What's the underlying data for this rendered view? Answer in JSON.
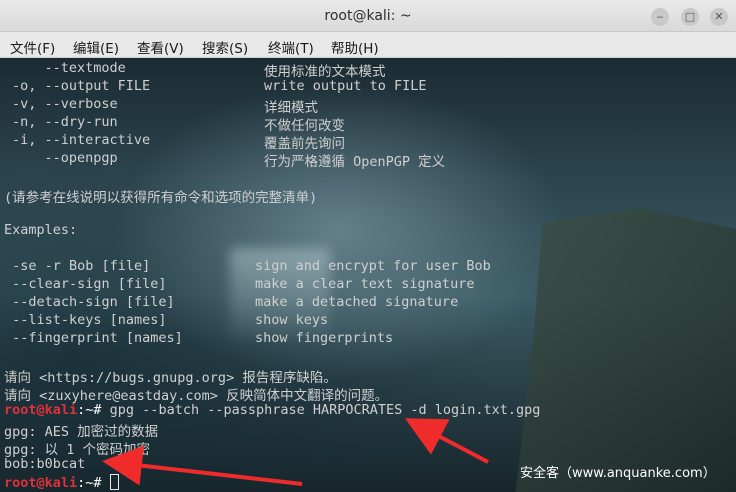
{
  "window": {
    "title": "root@kali: ~",
    "controls": {
      "minimize": "‒",
      "maximize": "□",
      "close": "✕"
    }
  },
  "menu": [
    "文件(F)",
    "编辑(E)",
    "查看(V)",
    "搜索(S)",
    "终端(T)",
    "帮助(H)"
  ],
  "options": [
    {
      "flag": "    --textmode",
      "desc": "使用标准的文本模式"
    },
    {
      "flag": "-o, --output FILE",
      "desc": "write output to FILE"
    },
    {
      "flag": "-v, --verbose",
      "desc": "详细模式"
    },
    {
      "flag": "-n, --dry-run",
      "desc": "不做任何改变"
    },
    {
      "flag": "-i, --interactive",
      "desc": "覆盖前先询问"
    },
    {
      "flag": "    --openpgp",
      "desc": "行为严格遵循 OpenPGP 定义"
    }
  ],
  "note": "(请参考在线说明以获得所有命令和选项的完整清单)",
  "examples_header": "Examples:",
  "examples": [
    {
      "cmd": " -se -r Bob [file]",
      "desc": "sign and encrypt for user Bob"
    },
    {
      "cmd": " --clear-sign [file]",
      "desc": "make a clear text signature"
    },
    {
      "cmd": " --detach-sign [file]",
      "desc": "make a detached signature"
    },
    {
      "cmd": " --list-keys [names]",
      "desc": "show keys"
    },
    {
      "cmd": " --fingerprint [names]",
      "desc": "show fingerprints"
    }
  ],
  "report": [
    "请向 <https://bugs.gnupg.org> 报告程序缺陷。",
    "请向 <zuxyhere@eastday.com> 反映简体中文翻译的问题。"
  ],
  "prompt": {
    "user": "root@kali",
    "sep": ":~# "
  },
  "command": "gpg --batch --passphrase HARPOCRATES -d login.txt.gpg",
  "output": [
    "gpg: AES 加密过的数据",
    "gpg: 以 1 个密码加密",
    "bob:b0bcat"
  ],
  "watermark": "安全客（www.anquanke.com）"
}
